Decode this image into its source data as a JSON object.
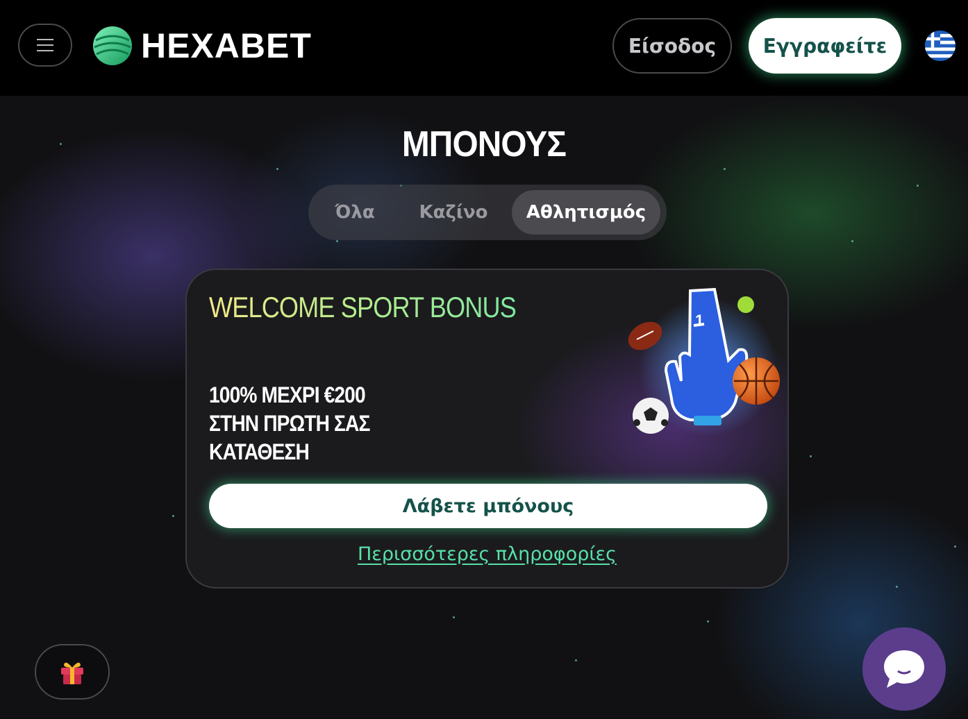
{
  "header": {
    "logo_text": "HEXABET",
    "login_label": "Είσοδος",
    "signup_label": "Εγγραφείτε",
    "language_flag": "greece-flag-icon"
  },
  "page": {
    "title": "ΜΠΟΝΟΥΣ"
  },
  "tabs": [
    {
      "label": "Όλα",
      "active": false
    },
    {
      "label": "Καζίνο",
      "active": false
    },
    {
      "label": "Αθλητισμός",
      "active": true
    }
  ],
  "bonus_card": {
    "title": "WELCOME SPORT BONUS",
    "offer_lines": [
      "100% ΜΕΧΡΙ €200",
      "ΣΤΗΝ ΠΡΩΤΗ ΣΑΣ",
      "ΚΑΤΑΘΕΣΗ"
    ],
    "claim_label": "Λάβετε μπόνους",
    "more_info_label": "Περισσότερες πληροφορίες",
    "art_icon": "sport-foam-hand-balls-icon"
  },
  "floating": {
    "gift_icon": "gift-icon",
    "chat_icon": "chat-bubble-icon"
  },
  "colors": {
    "accent_green": "#57e0a8",
    "button_text": "#14524a",
    "chat_purple": "#5b3d8c"
  }
}
